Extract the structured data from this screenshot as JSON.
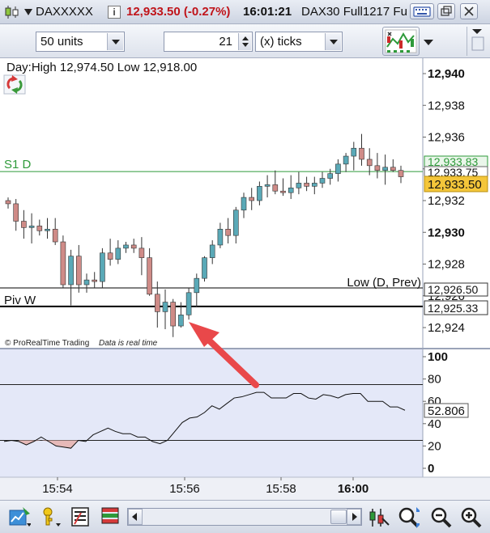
{
  "titlebar": {
    "instrument": "DAXXXXX",
    "info_icon": "i",
    "price_change": "12,933.50 (-0.27%)",
    "time": "16:01:21",
    "contract": "DAX30 Full1217 Fu"
  },
  "toolbar": {
    "units_value": "50 units",
    "ticks_number": "21",
    "ticks_unit": "(x) ticks"
  },
  "chart": {
    "header": "Day:High 12,974.50 Low 12,918.00",
    "s1_label": "S1 D",
    "piv_label": "Piv W",
    "low_label": "Low (D, Prev)",
    "credits_brand": "© ProRealTime Trading",
    "credits_note": "Data is real time",
    "price_axis": [
      "12,940",
      "12,938",
      "12,936",
      "12,934",
      "12,932",
      "12,930",
      "12,928",
      "12,926",
      "12,924"
    ],
    "badges": {
      "s1_value": "12,933.83",
      "mid_value": "12,933.75",
      "last_value": "12,933.50",
      "low_value": "12,926.50",
      "piv_value": "12,925.33"
    },
    "osc_axis": [
      "100",
      "80",
      "60",
      "40",
      "20",
      "0"
    ],
    "osc_value": "52.806",
    "time_axis": [
      "15:54",
      "15:56",
      "15:58",
      "16:00"
    ]
  },
  "chart_data": [
    {
      "type": "candlestick",
      "title": "Day:High 12,974.50 Low 12,918.00",
      "ylim": [
        12923.0,
        12941.0
      ],
      "time_labels": [
        "15:54",
        "15:56",
        "15:58",
        "16:00"
      ],
      "levels": [
        {
          "name": "S1 D",
          "value": 12933.83
        },
        {
          "name": "Low (D, Prev)",
          "value": 12926.5
        },
        {
          "name": "Piv W",
          "value": 12925.33
        }
      ],
      "last": 12933.5,
      "candles": [
        {
          "o": 12932.0,
          "h": 12932.2,
          "l": 12931.5,
          "c": 12931.8
        },
        {
          "o": 12931.8,
          "h": 12932.1,
          "l": 12930.1,
          "c": 12930.7
        },
        {
          "o": 12930.7,
          "h": 12931.4,
          "l": 12929.6,
          "c": 12930.3
        },
        {
          "o": 12930.3,
          "h": 12931.2,
          "l": 12929.3,
          "c": 12930.4
        },
        {
          "o": 12930.4,
          "h": 12930.8,
          "l": 12929.8,
          "c": 12930.1
        },
        {
          "o": 12930.1,
          "h": 12930.9,
          "l": 12929.6,
          "c": 12930.2
        },
        {
          "o": 12930.2,
          "h": 12930.9,
          "l": 12929.2,
          "c": 12929.4
        },
        {
          "o": 12929.4,
          "h": 12929.8,
          "l": 12926.5,
          "c": 12926.7
        },
        {
          "o": 12926.7,
          "h": 12928.9,
          "l": 12925.4,
          "c": 12928.5
        },
        {
          "o": 12928.5,
          "h": 12929.2,
          "l": 12926.2,
          "c": 12926.7
        },
        {
          "o": 12926.7,
          "h": 12927.4,
          "l": 12926.2,
          "c": 12927.0
        },
        {
          "o": 12927.0,
          "h": 12927.5,
          "l": 12926.5,
          "c": 12926.9
        },
        {
          "o": 12926.9,
          "h": 12929.0,
          "l": 12926.5,
          "c": 12928.7
        },
        {
          "o": 12928.7,
          "h": 12929.6,
          "l": 12927.9,
          "c": 12928.3
        },
        {
          "o": 12928.3,
          "h": 12929.5,
          "l": 12928.0,
          "c": 12929.0
        },
        {
          "o": 12929.0,
          "h": 12929.4,
          "l": 12928.7,
          "c": 12929.2
        },
        {
          "o": 12929.2,
          "h": 12929.6,
          "l": 12928.7,
          "c": 12929.0
        },
        {
          "o": 12929.0,
          "h": 12929.7,
          "l": 12927.3,
          "c": 12928.4
        },
        {
          "o": 12928.4,
          "h": 12929.0,
          "l": 12926.0,
          "c": 12926.1
        },
        {
          "o": 12926.1,
          "h": 12926.9,
          "l": 12924.0,
          "c": 12925.0
        },
        {
          "o": 12925.0,
          "h": 12926.4,
          "l": 12923.9,
          "c": 12925.6
        },
        {
          "o": 12925.6,
          "h": 12925.8,
          "l": 12923.4,
          "c": 12924.1
        },
        {
          "o": 12924.1,
          "h": 12925.6,
          "l": 12924.0,
          "c": 12924.8
        },
        {
          "o": 12924.8,
          "h": 12926.5,
          "l": 12924.5,
          "c": 12926.2
        },
        {
          "o": 12926.2,
          "h": 12927.4,
          "l": 12925.3,
          "c": 12927.1
        },
        {
          "o": 12927.1,
          "h": 12928.5,
          "l": 12926.9,
          "c": 12928.4
        },
        {
          "o": 12928.4,
          "h": 12929.5,
          "l": 12928.0,
          "c": 12929.2
        },
        {
          "o": 12929.2,
          "h": 12930.6,
          "l": 12929.0,
          "c": 12930.2
        },
        {
          "o": 12930.2,
          "h": 12930.9,
          "l": 12929.3,
          "c": 12929.8
        },
        {
          "o": 12929.8,
          "h": 12931.6,
          "l": 12929.3,
          "c": 12931.4
        },
        {
          "o": 12931.4,
          "h": 12932.5,
          "l": 12930.9,
          "c": 12932.2
        },
        {
          "o": 12932.2,
          "h": 12932.8,
          "l": 12931.4,
          "c": 12932.0
        },
        {
          "o": 12932.0,
          "h": 12933.2,
          "l": 12931.7,
          "c": 12932.9
        },
        {
          "o": 12932.9,
          "h": 12933.6,
          "l": 12932.2,
          "c": 12933.0
        },
        {
          "o": 12933.0,
          "h": 12933.9,
          "l": 12932.4,
          "c": 12932.6
        },
        {
          "o": 12932.6,
          "h": 12933.4,
          "l": 12932.3,
          "c": 12932.5
        },
        {
          "o": 12932.5,
          "h": 12933.6,
          "l": 12932.1,
          "c": 12932.8
        },
        {
          "o": 12932.8,
          "h": 12933.8,
          "l": 12932.4,
          "c": 12933.1
        },
        {
          "o": 12933.1,
          "h": 12933.5,
          "l": 12932.6,
          "c": 12932.9
        },
        {
          "o": 12932.9,
          "h": 12933.5,
          "l": 12932.4,
          "c": 12933.1
        },
        {
          "o": 12933.1,
          "h": 12933.8,
          "l": 12932.8,
          "c": 12933.4
        },
        {
          "o": 12933.4,
          "h": 12934.0,
          "l": 12933.0,
          "c": 12933.7
        },
        {
          "o": 12933.7,
          "h": 12934.6,
          "l": 12933.2,
          "c": 12934.3
        },
        {
          "o": 12934.3,
          "h": 12935.0,
          "l": 12933.8,
          "c": 12934.8
        },
        {
          "o": 12934.8,
          "h": 12935.7,
          "l": 12933.9,
          "c": 12935.3
        },
        {
          "o": 12935.3,
          "h": 12936.2,
          "l": 12934.2,
          "c": 12934.6
        },
        {
          "o": 12934.6,
          "h": 12935.3,
          "l": 12933.6,
          "c": 12934.2
        },
        {
          "o": 12934.2,
          "h": 12935.0,
          "l": 12933.4,
          "c": 12933.9
        },
        {
          "o": 12933.9,
          "h": 12934.9,
          "l": 12933.0,
          "c": 12934.1
        },
        {
          "o": 12934.1,
          "h": 12934.6,
          "l": 12933.8,
          "c": 12933.9
        },
        {
          "o": 12933.9,
          "h": 12934.2,
          "l": 12933.1,
          "c": 12933.5
        }
      ]
    },
    {
      "type": "line",
      "title": "",
      "ylim": [
        0,
        100
      ],
      "reference_lines": [
        75,
        25
      ],
      "last": 52.806,
      "values": [
        24,
        25,
        24,
        21,
        24,
        28,
        24,
        20,
        19,
        18,
        25,
        24,
        30,
        33,
        36,
        33,
        31,
        31,
        28,
        28,
        24,
        22,
        25,
        33,
        41,
        45,
        46,
        50,
        56,
        53,
        58,
        63,
        64,
        66,
        68,
        68,
        63,
        63,
        63,
        67,
        67,
        63,
        62,
        66,
        65,
        63,
        66,
        67,
        67,
        60,
        60,
        60,
        55,
        55,
        52
      ]
    }
  ],
  "colors": {
    "bull": "#5aa9b7",
    "bear": "#cf8b87",
    "s1_line": "#2e9a3a",
    "last_badge": "#f4c63a",
    "price_red": "#c0141a",
    "arrow": "#e9484a"
  },
  "icons": {
    "title_left": "candlestick-icon",
    "info": "info-icon",
    "keyboard": "keyboard-icon",
    "restore": "restore-icon",
    "close": "close-icon",
    "strategy": "strategy-chart-icon",
    "refresh": "refresh-arrows-icon",
    "b1": "draw-tool-icon",
    "b2": "alert-bell-icon",
    "b3": "indicator-list-icon",
    "b4": "order-book-icon",
    "b5": "cursor-tool-icon",
    "b6": "zoom-auto-icon",
    "b7": "zoom-out-icon",
    "b8": "zoom-in-icon"
  }
}
